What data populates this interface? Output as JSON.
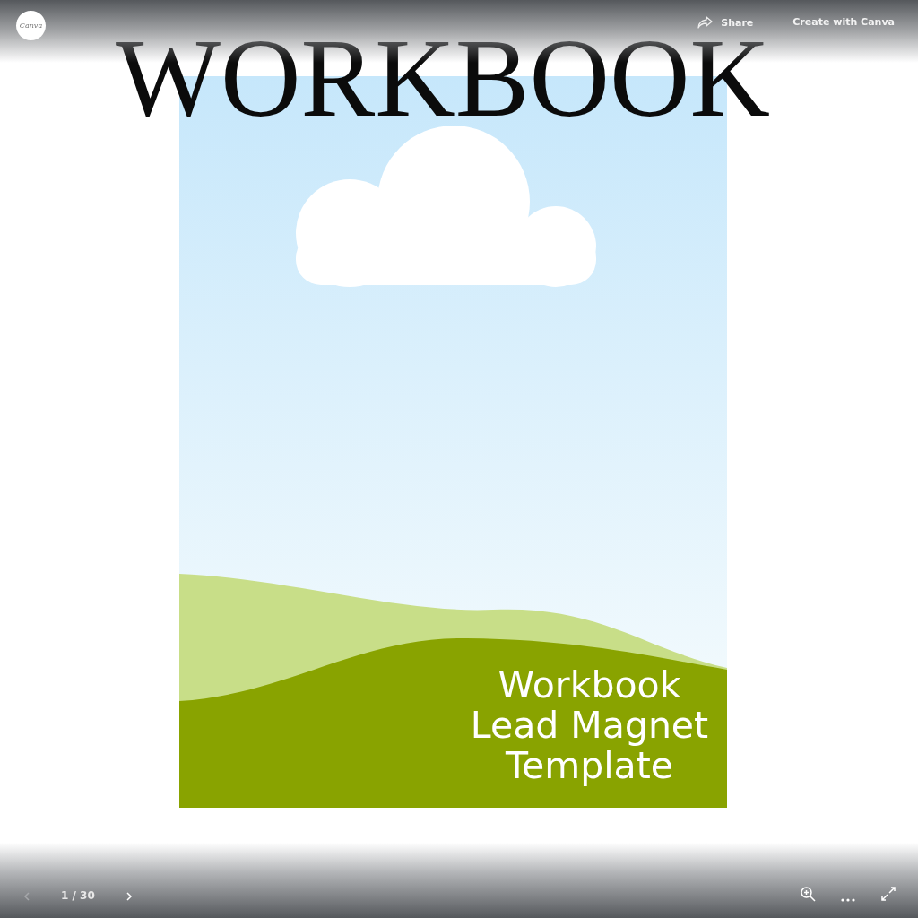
{
  "top_bar": {
    "logo": "Canva",
    "share": "Share",
    "create": "Create with Canva"
  },
  "slide": {
    "title": "WORKBOOK",
    "subtitle": "Workbook Lead Magnet Template"
  },
  "bottom_bar": {
    "prev": {
      "disabled": true
    },
    "page": "1 / 30",
    "next": {
      "disabled": false
    }
  }
}
